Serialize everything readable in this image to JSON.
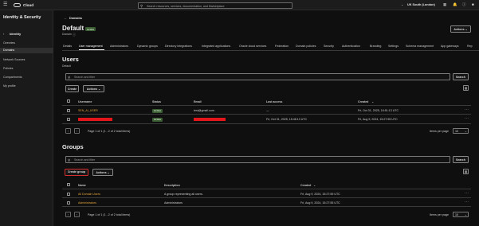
{
  "topbar": {
    "brand": "Cloud",
    "search_placeholder": "Search resources, services, documentation, and Marketplace",
    "region": "UK South (London)"
  },
  "sidebar": {
    "title": "Identity & Security",
    "back_label": "Identity",
    "items": [
      {
        "label": "Overview"
      },
      {
        "label": "Domains"
      },
      {
        "label": "Network Sources"
      },
      {
        "label": "Policies"
      },
      {
        "label": "Compartments"
      },
      {
        "label": "My profile"
      }
    ]
  },
  "breadcrumb": {
    "label": "Domains"
  },
  "header": {
    "title": "Default",
    "status": "Active",
    "subtitle": "Domain",
    "actions_label": "Actions"
  },
  "tabs": [
    "Details",
    "User management",
    "Administrators",
    "Dynamic groups",
    "Directory integrations",
    "Integrated applications",
    "Oracle cloud services",
    "Federation",
    "Domain policies",
    "Security",
    "Authentication",
    "Branding",
    "Settings",
    "Schema management",
    "App gateways",
    "Rep"
  ],
  "users": {
    "title": "Users",
    "subtitle": "Default",
    "search_placeholder": "Search and filter",
    "search_button": "Search",
    "create_button": "Create",
    "actions_button": "Actions",
    "columns": [
      "Username",
      "Status",
      "Email",
      "Last access",
      "Created"
    ],
    "rows": [
      {
        "username": "SEN_AI_USER",
        "status": "Active",
        "email": "test@gmail.com",
        "last_access": "—",
        "created": "Fri, Oct 31, 2025, 16:51:13 UTC"
      },
      {
        "username": "",
        "status": "Active",
        "email": "",
        "last_access": "Fri, Oct 31, 2025, 15:46:13 UTC",
        "created": "Fri, Aug 9, 2024, 15:27:55 UTC"
      }
    ],
    "pagination": "Page 1 of 1 (1 - 2 of 2 total items)",
    "items_per_page_label": "Items per page",
    "items_per_page": "10"
  },
  "groups": {
    "title": "Groups",
    "search_placeholder": "Search and filter",
    "search_button": "Search",
    "create_button": "Create group",
    "actions_button": "Actions",
    "columns": [
      "Name",
      "Description",
      "Created"
    ],
    "rows": [
      {
        "name": "All Domain Users",
        "description": "A group representing all users.",
        "created": "Fri, Aug 9, 2024, 15:27:59 UTC"
      },
      {
        "name": "Administrators",
        "description": "Administrators",
        "created": "Fri, Aug 9, 2024, 15:27:55 UTC"
      }
    ],
    "pagination": "Page 1 of 1 (1 - 2 of 2 total items)",
    "items_per_page_label": "Items per page",
    "items_per_page": "10"
  },
  "colors": {
    "accent_link": "#e3a33a",
    "status_badge": "#3b5d33",
    "highlight": "#d32f2f"
  }
}
